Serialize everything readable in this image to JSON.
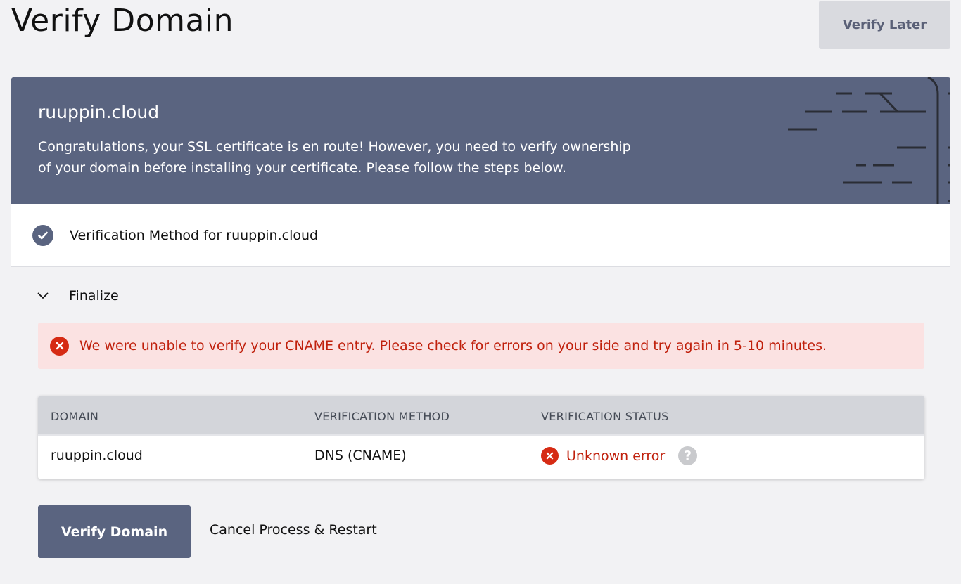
{
  "page": {
    "title": "Verify Domain",
    "verify_later_label": "Verify Later"
  },
  "banner": {
    "domain": "ruuppin.cloud",
    "message_line1": "Congratulations, your SSL certificate is en route! However, you need to verify ownership",
    "message_line2": "of your domain before installing your certificate. Please follow the steps below."
  },
  "steps": {
    "method": {
      "label": "Verification Method for ruuppin.cloud",
      "icon": "check-circle-icon"
    },
    "finalize": {
      "label": "Finalize",
      "icon": "chevron-down-icon"
    }
  },
  "alert": {
    "message": "We were unable to verify your CNAME entry. Please check for errors on your side and try again in 5-10 minutes.",
    "icon": "error-x-icon",
    "color": "#c0200c",
    "background": "#fbe2e2"
  },
  "table": {
    "headers": [
      "DOMAIN",
      "VERIFICATION METHOD",
      "VERIFICATION STATUS"
    ],
    "rows": [
      {
        "domain": "ruuppin.cloud",
        "method": "DNS (CNAME)",
        "status": "Unknown error"
      }
    ]
  },
  "actions": {
    "verify_label": "Verify Domain",
    "cancel_label": "Cancel Process & Restart"
  },
  "colors": {
    "brand": "#5a6480",
    "error": "#d62b14",
    "page_bg": "#f2f2f4"
  }
}
